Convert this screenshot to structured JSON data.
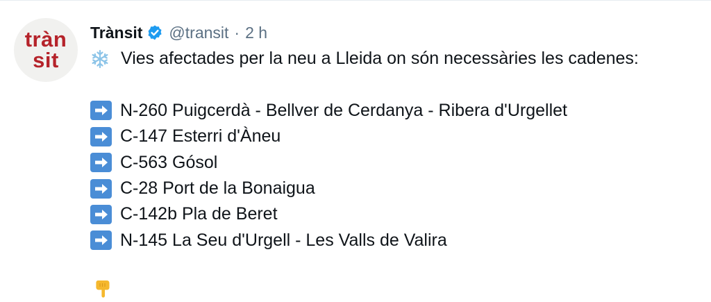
{
  "tweet": {
    "avatar": {
      "line1": "tràn",
      "line2": "sit",
      "color": "#b5232a"
    },
    "display_name": "Trànsit",
    "handle": "@transit",
    "separator": "·",
    "time": "2 h",
    "icons": {
      "verified": "verified-badge-icon",
      "snow": "snowflake-icon",
      "arrow": "right-arrow-icon",
      "hand": "pointing-down-hand-icon"
    },
    "intro": "Vies afectades per la neu a Lleida on són necessàries les cadenes:",
    "roads": [
      "N-260 Puigcerdà - Bellver de Cerdanya - Ribera d'Urgellet",
      "C-147 Esterri d'Àneu",
      "C-563 Gósol",
      "C-28 Port de la Bonaigua",
      "C-142b Pla de Beret",
      "N-145 La Seu d'Urgell - Les Valls de Valira"
    ]
  }
}
